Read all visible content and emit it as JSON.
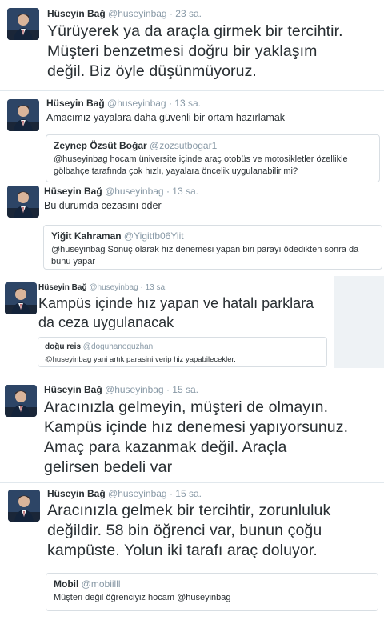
{
  "tweets": [
    {
      "name": "Hüseyin Bağ",
      "handle": "@huseyinbag",
      "time": "23 sa.",
      "text": "Yürüyerek ya da araçla girmek bir tercihtir.\nMüşteri benzetmesi doğru bir yaklaşım\ndeğil. Biz öyle düşünmüyoruz."
    },
    {
      "name": "Hüseyin Bağ",
      "handle": "@huseyinbag",
      "time": "13 sa.",
      "text": "Amacımız yayalara daha güvenli bir ortam hazırlamak",
      "quote": {
        "name": "Zeynep Özsüt Boğar",
        "handle": "@zozsutbogar1",
        "text": "@huseyinbag hocam üniversite içinde araç otobüs ve motosikletler özellikle gölbahçe tarafında çok hızlı, yayalara öncelik uygulanabilir mi?"
      }
    },
    {
      "name": "Hüseyin Bağ",
      "handle": "@huseyinbag",
      "time": "13 sa.",
      "text": "Bu durumda cezasını öder",
      "quote": {
        "name": "Yiğit Kahraman",
        "handle": "@Yigitfb06Yiit",
        "text": "@huseyinbag Sonuç olarak hız denemesi yapan biri parayı ödedikten sonra da bunu yapar"
      }
    },
    {
      "name": "Hüseyin Bağ",
      "handle": "@huseyinbag",
      "time": "13 sa.",
      "text": "Kampüs içinde hız yapan ve hatalı parklara\nda ceza uygulanacak",
      "quote": {
        "name": "doğu reis",
        "handle": "@doguhanoguzhan",
        "text": "@huseyinbag yani artık parasini verip hiz yapabilecekler."
      }
    },
    {
      "name": "Hüseyin Bağ",
      "handle": "@huseyinbag",
      "time": "15 sa.",
      "text": "Aracınızla gelmeyin, müşteri de olmayın.\nKampüs içinde hız denemesi yapıyorsunuz.\nAmaç para kazanmak değil. Araçla\ngelirsen bedeli var"
    },
    {
      "name": "Hüseyin Bağ",
      "handle": "@huseyinbag",
      "time": "15 sa.",
      "text": "Aracınızla gelmek bir tercihtir, zorunluluk\ndeğildir. 58 bin öğrenci var, bunun çoğu\nkampüste. Yolun iki tarafı araç doluyor.",
      "quote": {
        "name": "Mobil",
        "handle": "@mobiilll",
        "text": "Müşteri değil öğrenciyiz hocam  @huseyinbag"
      }
    }
  ],
  "dot": "·"
}
